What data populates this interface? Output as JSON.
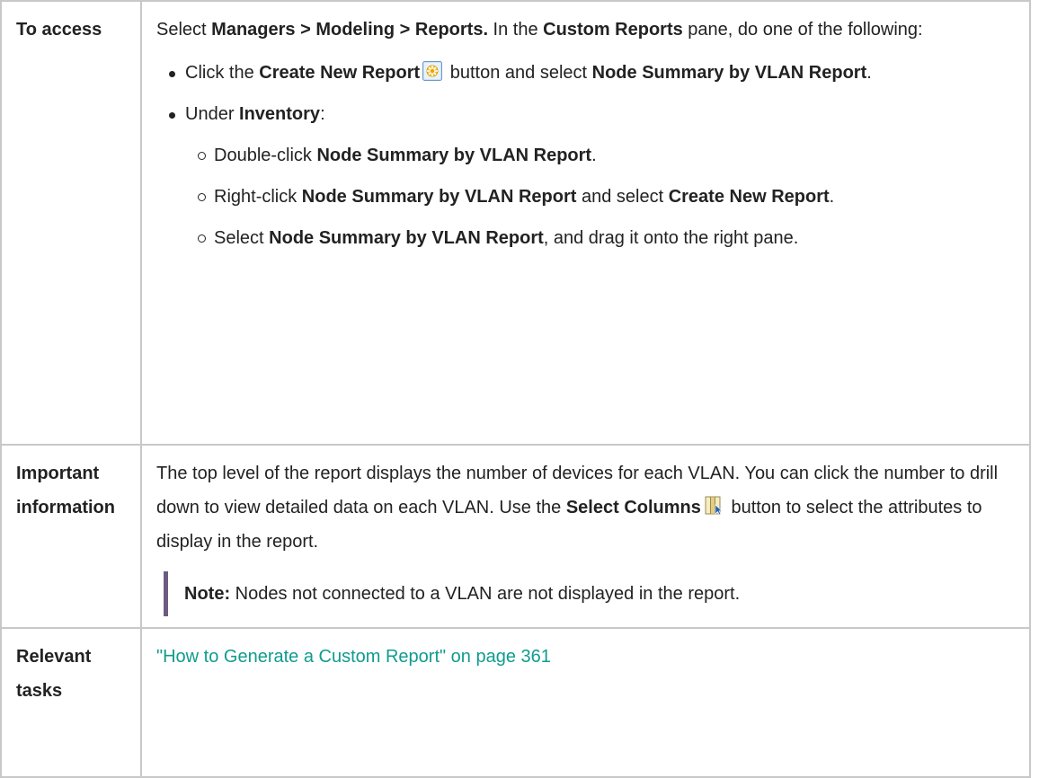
{
  "rows": {
    "access": {
      "heading": "To access",
      "intro": {
        "t1": "Select ",
        "b1": "Managers > Modeling > Reports.",
        "t2": " In the ",
        "b2": "Custom Reports",
        "t3": " pane, do one of the following:"
      },
      "bullet1": {
        "t1": "Click the ",
        "b1": "Create New Report",
        "t2": " button and select ",
        "b2": "Node Summary by VLAN Report",
        "t3": "."
      },
      "bullet2": {
        "t1": "Under ",
        "b1": "Inventory",
        "t2": ":"
      },
      "sub1": {
        "t1": "Double-click ",
        "b1": "Node Summary by VLAN Report",
        "t2": "."
      },
      "sub2": {
        "t1": "Right-click ",
        "b1": "Node Summary by VLAN Report",
        "t2": " and select ",
        "b2": "Create New Report",
        "t3": "."
      },
      "sub3": {
        "t1": "Select ",
        "b1": "Node Summary by VLAN Report",
        "t2": ", and drag it onto the right pane."
      }
    },
    "info": {
      "heading": "Important information",
      "body": {
        "t1": "The top level of the report displays the number of devices for each VLAN. You can click the number to drill down to view detailed data on each VLAN. Use the ",
        "b1": "Select Columns",
        "t2": " button to select the attributes to display in the report."
      },
      "note": {
        "label": "Note:",
        "text": " Nodes not connected to a VLAN are not displayed in the report."
      }
    },
    "tasks": {
      "heading": "Relevant tasks",
      "link": "\"How to Generate a Custom Report\" on page 361"
    }
  },
  "icons": {
    "create_new_report": "create-new-report-icon",
    "select_columns": "select-columns-icon"
  },
  "colors": {
    "link": "#0f9c8e",
    "note_bar": "#6c5a83",
    "border": "#c8c8c8"
  }
}
